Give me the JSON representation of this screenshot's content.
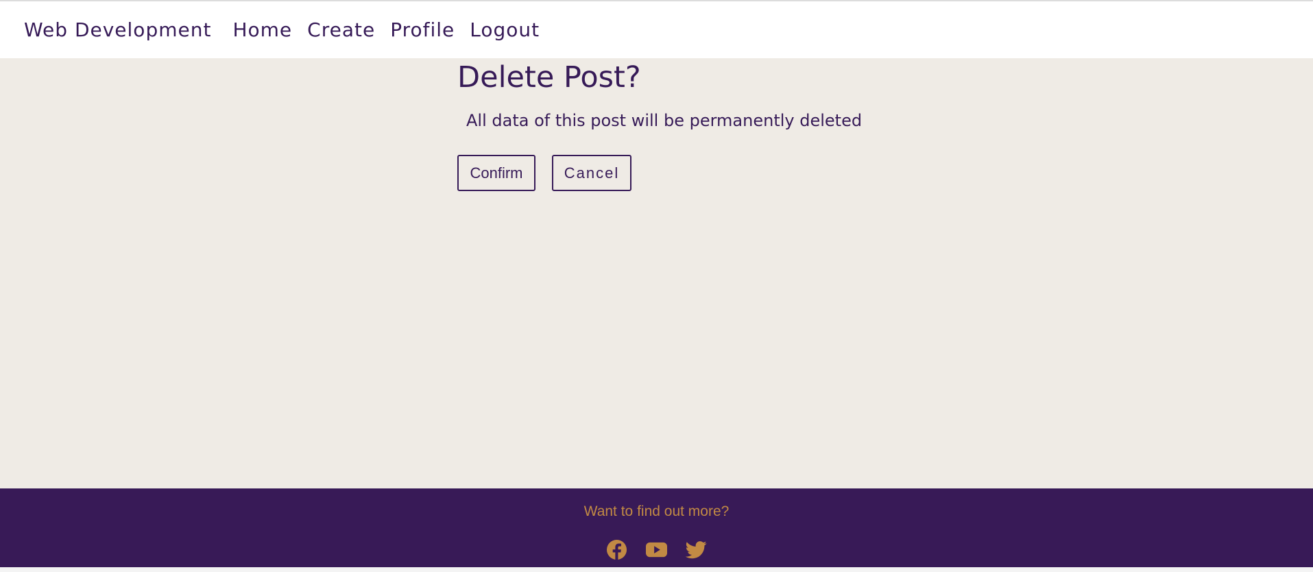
{
  "nav": {
    "brand": "Web Development",
    "links": [
      "Home",
      "Create",
      "Profile",
      "Logout"
    ]
  },
  "main": {
    "title": "Delete Post?",
    "description": "All data of this post will be permanently deleted",
    "confirm_label": "Confirm",
    "cancel_label": "Cancel"
  },
  "footer": {
    "text": "Want to find out more?",
    "social": [
      "facebook-icon",
      "youtube-icon",
      "twitter-icon"
    ]
  },
  "colors": {
    "primary": "#361a57",
    "background": "#efebe5",
    "footer_bg": "#381a57",
    "accent": "#c28a44"
  }
}
